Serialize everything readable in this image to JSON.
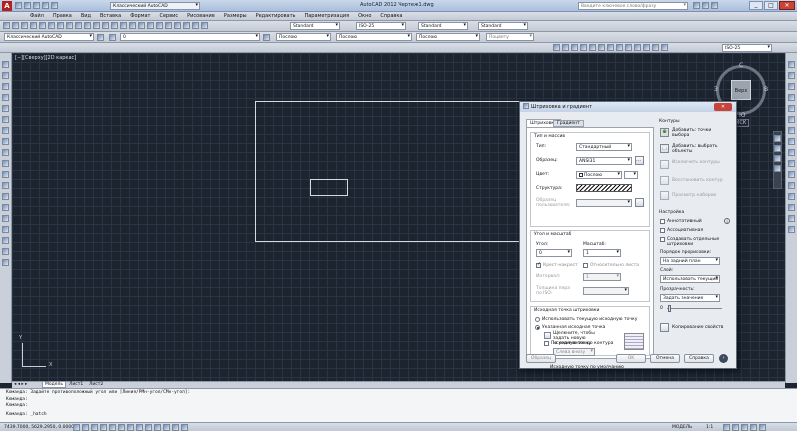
{
  "window": {
    "workspace_combo": "Классический AutoCAD",
    "title": "AutoCAD 2012   Чертеж1.dwg",
    "search_placeholder": "Введите ключевое слово/фразу"
  },
  "menu": [
    "Файл",
    "Правка",
    "Вид",
    "Вставка",
    "Формат",
    "Сервис",
    "Рисование",
    "Размеры",
    "Редактировать",
    "Параметризация",
    "Окно",
    "Справка"
  ],
  "styles": {
    "text_style": "Standard",
    "dim_style": "ISO-25",
    "table_style": "Standard",
    "mleader_style": "Standard"
  },
  "layers": {
    "workspace": "Классический AutoCAD",
    "layer": "0"
  },
  "properties": {
    "color": "Послою",
    "linetype": "Послою",
    "lineweight": "Послою",
    "plotstyle": "Поцвету"
  },
  "viewport_label": "[−][Сверху][2D каркас]",
  "viewcube": {
    "face": "Верх",
    "n": "С",
    "e": "В",
    "s": "Ю",
    "w": "З",
    "wcs": "МСК"
  },
  "layout_tabs": [
    "Модель",
    "Лист1",
    "Лист2"
  ],
  "command_history": [
    "Команда: Задайте противоположный угол или [Линия/РМн-угол/СМн-угол]:",
    "Команда:",
    "Команда:"
  ],
  "command_prompt": "Команда: _hatch",
  "status_coords": "7439.7000, 5629.2950, 0.0000",
  "status_model": "МОДЕЛЬ",
  "status_scale": "1:1",
  "dialog": {
    "title": "Штриховка и градиент",
    "tabs": [
      "Штриховка",
      "Градиент"
    ],
    "type_pattern": {
      "section": "Тип и массив",
      "type_label": "Тип:",
      "type_value": "Стандартный",
      "pattern_label": "Образец:",
      "pattern_value": "ANSI31",
      "color_label": "Цвет:",
      "color_value": "Послою",
      "swatch_label": "Структура:",
      "custom_label": "Образец пользователя:"
    },
    "angle_scale": {
      "section": "Угол и масштаб",
      "angle_label": "Угол:",
      "angle_value": "0",
      "scale_label": "Масштаб:",
      "scale_value": "1",
      "double_label": "Крест-накрест",
      "relative_label": "Относительно листа",
      "spacing_label": "Интервал:",
      "spacing_value": "1",
      "iso_label": "Толщина пера по ISO:"
    },
    "origin": {
      "section": "Исходная точка штриховки",
      "current_label": "Использовать текущую исходную точку",
      "specified_label": "Указанная исходная точка",
      "click_label": "Щелкните, чтобы задать новую исходную точку",
      "default_extents_label": "По умолчанию до контура",
      "position_value": "Слева внизу",
      "store_label": "Исходную точку по умолчанию"
    },
    "boundaries": {
      "section": "Контуры",
      "add_pick": "Добавить: точки выбора",
      "add_select": "Добавить: выбрать объекты",
      "remove": "Исключить контуры",
      "recreate": "Восстановить контур",
      "view": "Просмотр наборов"
    },
    "options": {
      "section": "Настройка",
      "annotative": "Аннотативный",
      "associative": "Ассоциативная",
      "separate": "Создавать отдельные штриховки",
      "draw_order_label": "Порядок прорисовки:",
      "draw_order_value": "На задний план",
      "layer_label": "Слой:",
      "layer_value": "Использовать текущий",
      "transparency_label": "Прозрачность:",
      "transparency_value": "Задать значение",
      "transparency_amount": "0"
    },
    "inherit": "Копирование свойств",
    "buttons": {
      "preview": "Образец",
      "ok": "OK",
      "cancel": "Отмена",
      "help": "Справка"
    }
  },
  "colors": {
    "canvas": "#1c2430",
    "grid": "#2a3442",
    "accent": "#2f6fb0"
  }
}
